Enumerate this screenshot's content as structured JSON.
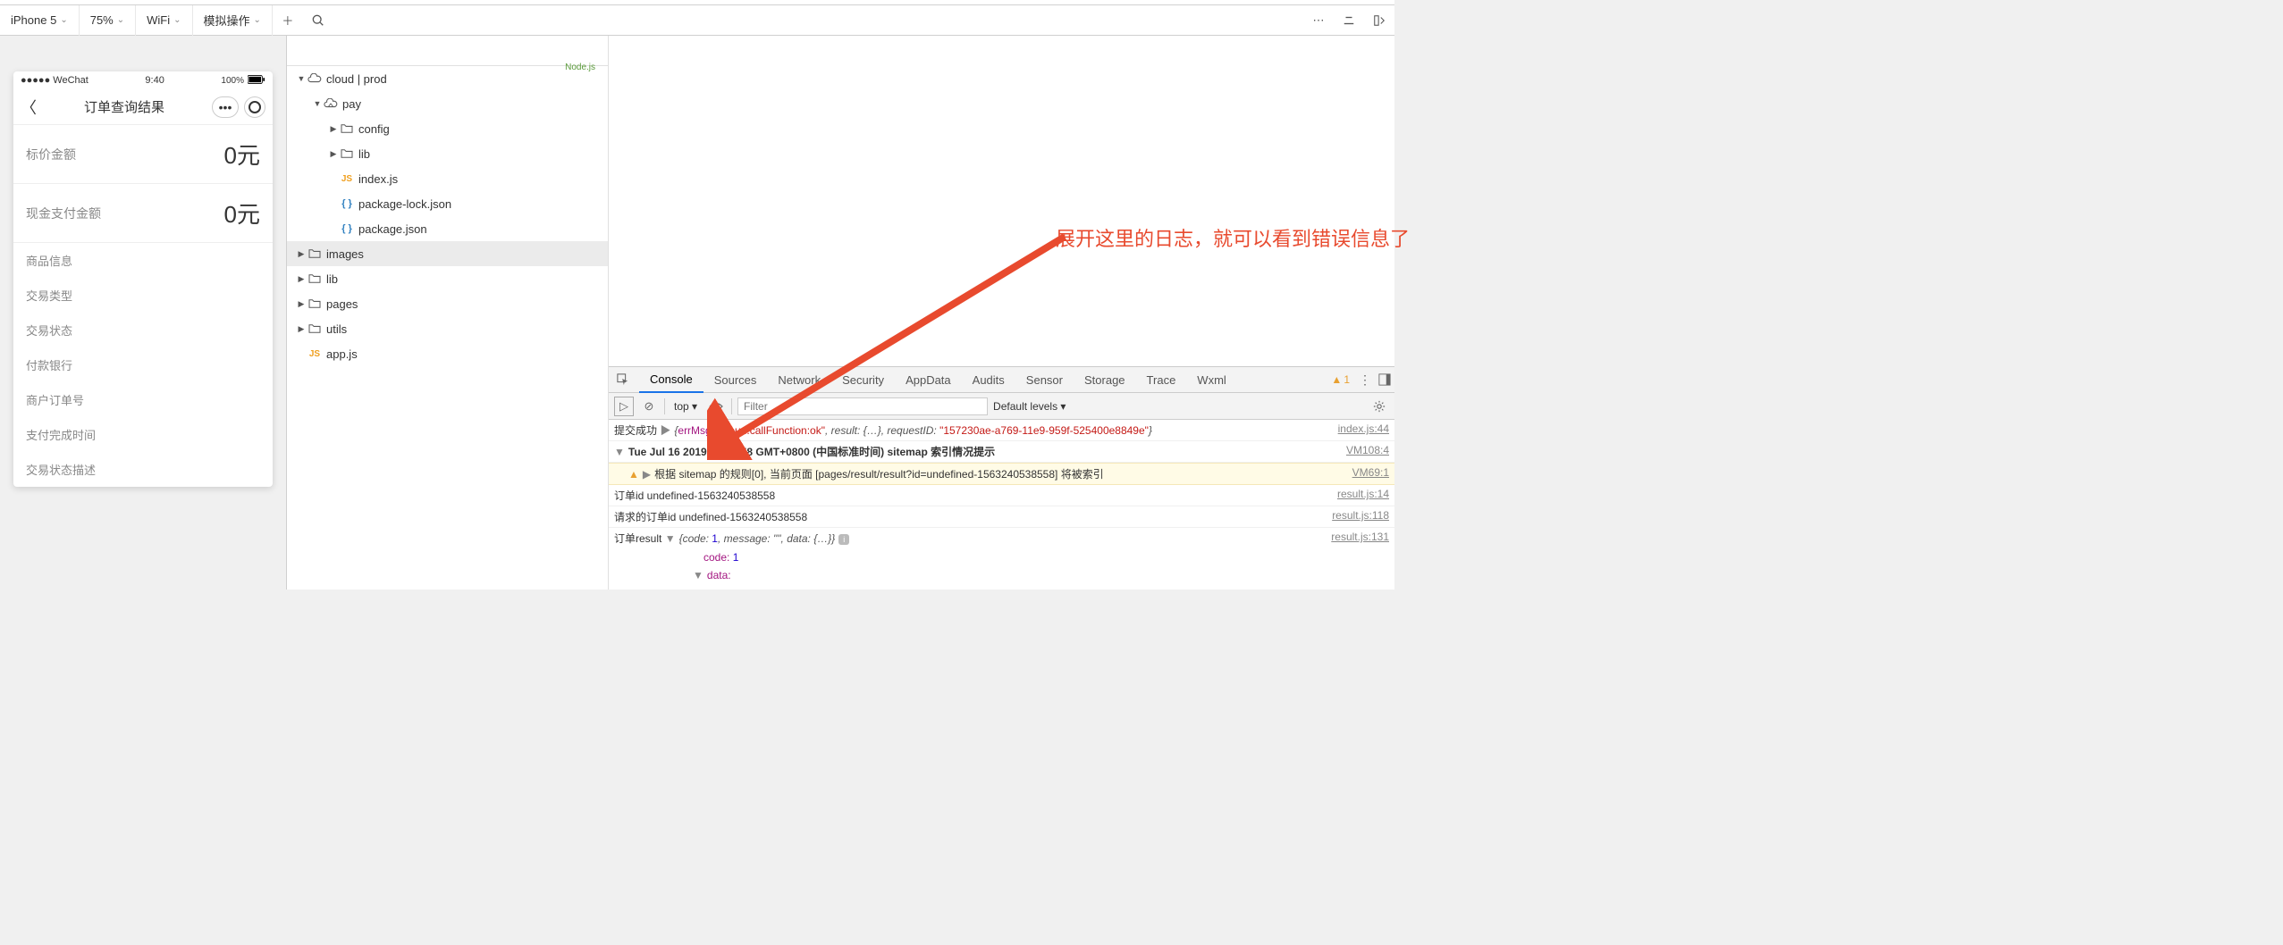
{
  "toolbar": {
    "device": "iPhone 5",
    "zoom": "75%",
    "network": "WiFi",
    "mock": "模拟操作"
  },
  "phone": {
    "carrier": "●●●●● WeChat",
    "time": "9:40",
    "battery": "100%",
    "nav_title": "订单查询结果",
    "rows_big": [
      {
        "label": "标价金额",
        "value": "0元"
      },
      {
        "label": "现金支付金额",
        "value": "0元"
      }
    ],
    "rows_small": [
      "商品信息",
      "交易类型",
      "交易状态",
      "付款银行",
      "商户订单号",
      "支付完成时间",
      "交易状态描述"
    ]
  },
  "tree": [
    {
      "depth": 0,
      "expand": "down",
      "icon": "cloud",
      "label": "cloud | prod"
    },
    {
      "depth": 1,
      "expand": "down",
      "icon": "cloudfn",
      "label": "pay"
    },
    {
      "depth": 2,
      "expand": "right",
      "icon": "folder",
      "label": "config"
    },
    {
      "depth": 2,
      "expand": "right",
      "icon": "folder",
      "label": "lib"
    },
    {
      "depth": 2,
      "expand": "",
      "icon": "js",
      "label": "index.js"
    },
    {
      "depth": 2,
      "expand": "",
      "icon": "json",
      "label": "package-lock.json"
    },
    {
      "depth": 2,
      "expand": "",
      "icon": "json",
      "label": "package.json"
    },
    {
      "depth": 0,
      "expand": "right",
      "icon": "folder",
      "label": "images",
      "sel": true
    },
    {
      "depth": 0,
      "expand": "right",
      "icon": "folder",
      "label": "lib"
    },
    {
      "depth": 0,
      "expand": "right",
      "icon": "folder",
      "label": "pages"
    },
    {
      "depth": 0,
      "expand": "right",
      "icon": "folder",
      "label": "utils"
    },
    {
      "depth": 0,
      "expand": "",
      "icon": "js",
      "label": "app.js"
    }
  ],
  "nodejs_badge": "Node.js",
  "devtabs": [
    "Console",
    "Sources",
    "Network",
    "Security",
    "AppData",
    "Audits",
    "Sensor",
    "Storage",
    "Trace",
    "Wxml"
  ],
  "devtabs_active": 0,
  "warn_count": "1",
  "filter": {
    "context": "top",
    "placeholder": "Filter",
    "levels": "Default levels"
  },
  "console": {
    "line1_prefix": "提交成功",
    "line1_errmsg_key": "errMsg:",
    "line1_errmsg_val": "\"cloud.callFunction:ok\"",
    "line1_result": ", result: {…}, requestID:",
    "line1_reqid": "\"157230ae-a769-11e9-959f-525400e8849e\"",
    "line1_src": "index.js:44",
    "line2_text": "Tue Jul 16 2019 09:28:58 GMT+0800 (中国标准时间) sitemap 索引情况提示",
    "line2_src": "VM108:4",
    "line3_text": "根据 sitemap 的规则[0], 当前页面 [pages/result/result?id=undefined-1563240538558] 将被索引",
    "line3_src": "VM69:1",
    "line4_text": "订单id undefined-1563240538558",
    "line4_src": "result.js:14",
    "line5_text": "请求的订单id undefined-1563240538558",
    "line5_src": "result.js:118",
    "line6_prefix": "订单result",
    "line6_obj": "{code: ",
    "line6_code": "1",
    "line6_msg": ", message: \"\", data: {…}}",
    "line6_src": "result.js:131",
    "line7_key": "code:",
    "line7_val": "1",
    "line8_key": "data:"
  },
  "annotation": "展开这里的日志，就可以看到错误信息了"
}
